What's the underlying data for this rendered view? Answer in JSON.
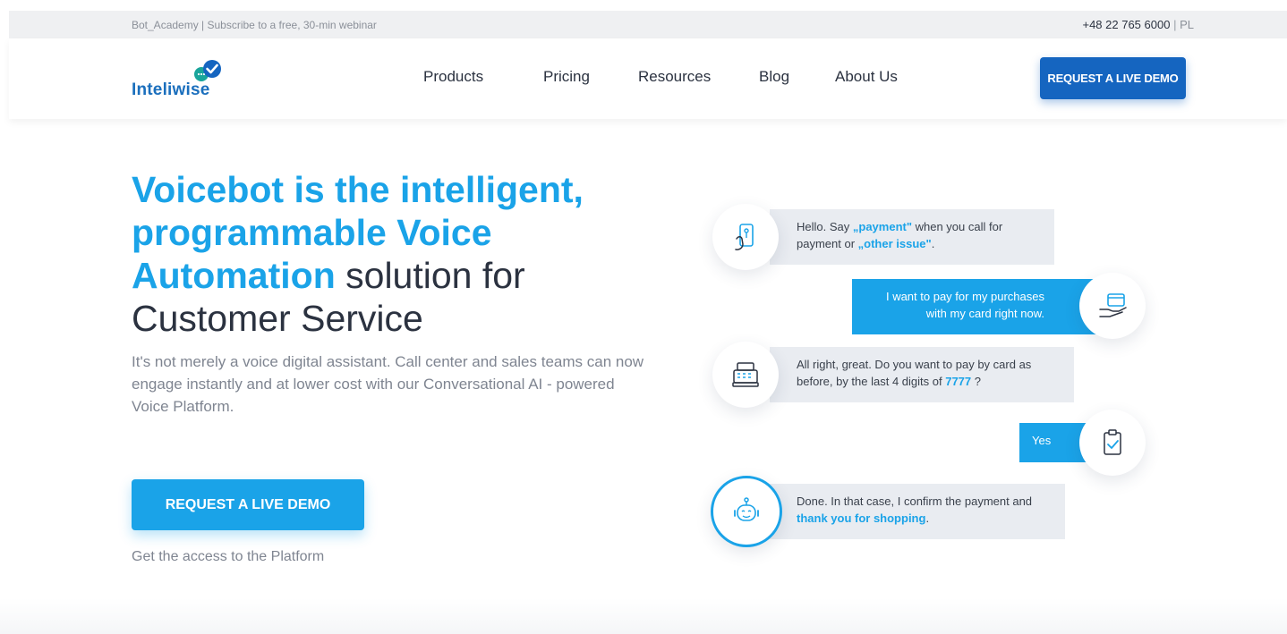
{
  "topbar": {
    "promo": "Bot_Academy | Subscribe to a free, 30-min webinar",
    "phone": "+48 22 765 6000",
    "separator": "|",
    "lang": "PL"
  },
  "header": {
    "logo_text": "Inteliwise",
    "nav": [
      "Products",
      "Pricing",
      "Resources",
      "Blog",
      "About Us"
    ],
    "cta": "REQUEST A LIVE DEMO"
  },
  "hero": {
    "title_highlight": "Voicebot is the intelligent, programmable Voice Automation",
    "title_rest": " solution for Customer Service",
    "title_line1": "Voicebot is the intelligent,",
    "title_line2": "programmable Voice",
    "title_line3a": "Automation",
    "title_line3b": " solution for",
    "title_line4": "Customer Service",
    "subtitle": "It's not merely a voice digital assistant. Call center and sales teams can now engage instantly and at lower cost with our Conversational AI - powered Voice Platform.",
    "cta": "REQUEST A LIVE DEMO",
    "cta_note": "Get the access to the Platform"
  },
  "chat": {
    "msg1_a": "Hello. Say ",
    "msg1_b": "„payment\"",
    "msg1_c": " when you call for payment or ",
    "msg1_d": "„other issue\"",
    "msg1_e": ".",
    "msg2": "I want to pay for my purchases with my card right now.",
    "msg3_a": "All right, great. Do you want to pay by card as before, by the last 4 digits of ",
    "msg3_b": "7777",
    "msg3_c": " ?",
    "msg4": "Yes",
    "msg5_a": "Done. In that case, I confirm the payment and ",
    "msg5_b": "thank you for shopping",
    "msg5_c": "."
  },
  "colors": {
    "accent": "#1aa3e8",
    "brand_dark": "#1565c0",
    "text": "#2b3240"
  }
}
